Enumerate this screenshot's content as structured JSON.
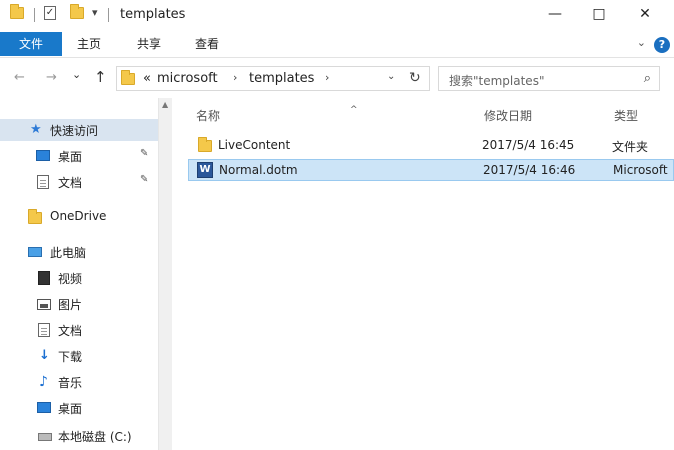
{
  "window": {
    "title": "templates",
    "quick_access_dropdown": "▾",
    "controls": {
      "minimize": "—",
      "maximize": "□",
      "close": "✕"
    }
  },
  "ribbon": {
    "tabs": [
      "文件",
      "主页",
      "共享",
      "查看"
    ],
    "collapse_icon": "chevron-down-icon",
    "help_label": "?"
  },
  "address": {
    "back": "←",
    "forward": "→",
    "recent": "⌄",
    "up": "↑",
    "overflow": "«",
    "crumbs": [
      "microsoft",
      "templates"
    ],
    "separator": "›",
    "dropdown": "⌄",
    "refresh": "↻"
  },
  "search": {
    "placeholder": "搜索\"templates\"",
    "icon": "search-icon"
  },
  "navigation": {
    "items": [
      {
        "label": "快速访问",
        "icon": "star-icon",
        "pinned": false
      },
      {
        "label": "桌面",
        "icon": "desktop-icon",
        "pinned": true
      },
      {
        "label": "文档",
        "icon": "document-icon",
        "pinned": true
      },
      {
        "label": "OneDrive",
        "icon": "folder-icon",
        "pinned": false
      },
      {
        "label": "此电脑",
        "icon": "computer-icon",
        "pinned": false
      },
      {
        "label": "视频",
        "icon": "video-icon",
        "pinned": false
      },
      {
        "label": "图片",
        "icon": "picture-icon",
        "pinned": false
      },
      {
        "label": "文档",
        "icon": "document-icon",
        "pinned": false
      },
      {
        "label": "下载",
        "icon": "download-icon",
        "pinned": false
      },
      {
        "label": "音乐",
        "icon": "music-icon",
        "pinned": false
      },
      {
        "label": "桌面",
        "icon": "desktop-icon",
        "pinned": false
      },
      {
        "label": "本地磁盘 (C:)",
        "icon": "drive-icon",
        "pinned": false
      }
    ],
    "pin_glyph": "✎"
  },
  "file_list": {
    "columns": {
      "name": "名称",
      "modified": "修改日期",
      "type": "类型"
    },
    "sort_indicator": "^",
    "rows": [
      {
        "name": "LiveContent",
        "modified": "2017/5/4 16:45",
        "type": "文件夹",
        "icon": "folder-icon",
        "selected": false
      },
      {
        "name": "Normal.dotm",
        "modified": "2017/5/4 16:46",
        "type": "Microsoft",
        "icon": "word-document-icon",
        "selected": true
      }
    ]
  },
  "colors": {
    "accent": "#1979ca",
    "selection": "#cce4f7",
    "folder": "#f4c84a"
  }
}
